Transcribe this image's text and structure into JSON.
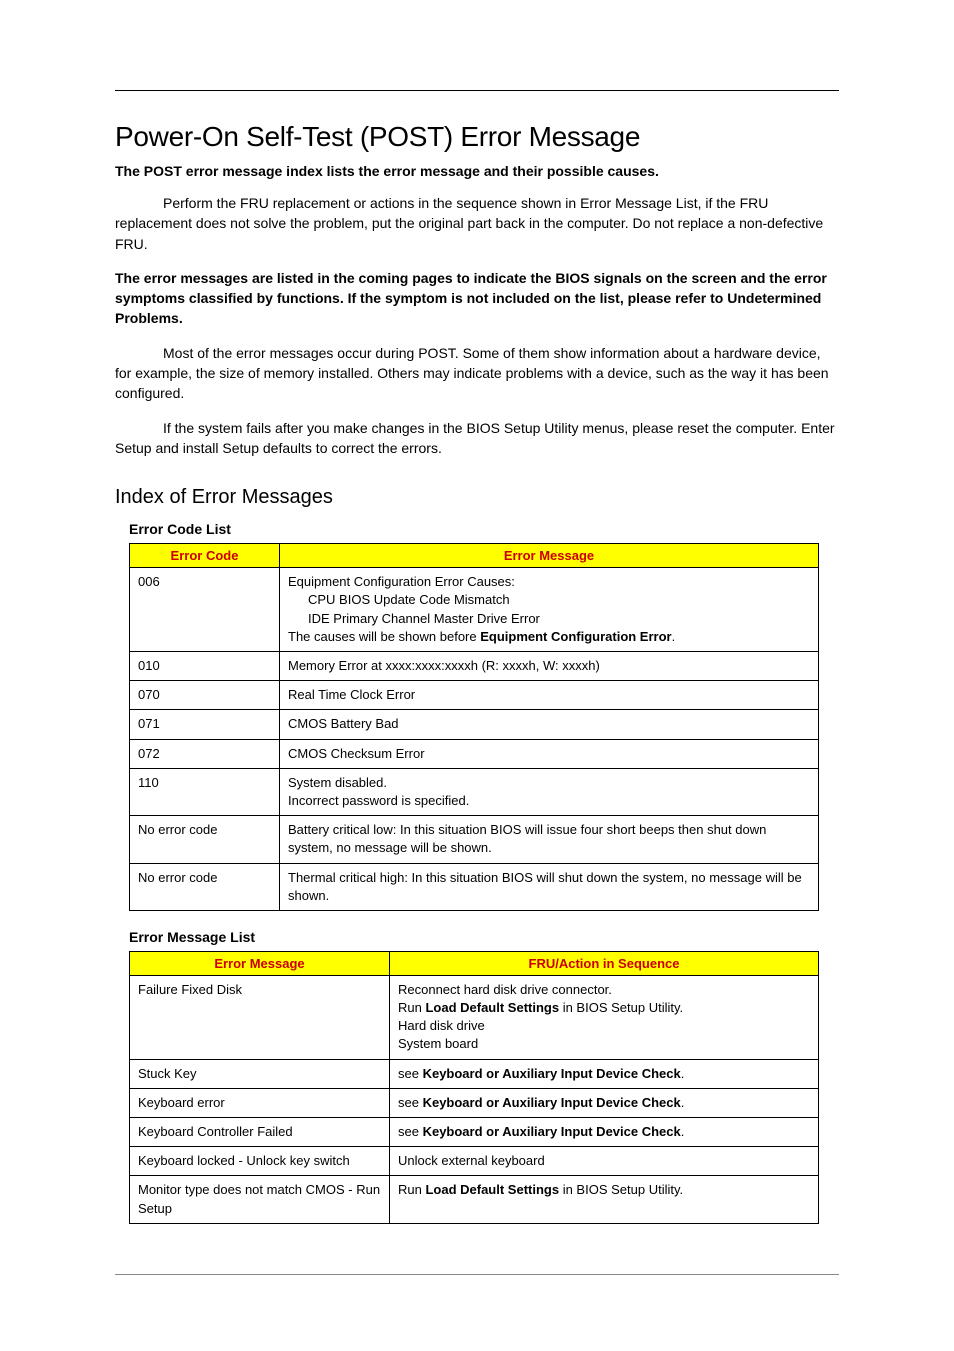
{
  "title": "Power-On Self-Test (POST) Error Message",
  "intro": "The POST error message index lists the error message and their possible causes.",
  "p1": "Perform the FRU replacement or actions in the sequence shown in Error Message List, if the FRU replacement does not solve the problem, put the original part back in the computer. Do not replace a non-defective FRU.",
  "p2_a": "The error messages are listed in the coming pages to indicate the BIOS signals on the screen and the error symptoms classified by functions. If the symptom is not included on the list, please refer to ",
  "p2_b": "Undetermined Problems",
  "p2_c": ".",
  "p3": "Most of the error messages occur during POST. Some of them show information about a hardware device, for example, the size of memory installed. Others may indicate problems with a device, such as the way it has been configured.",
  "p4": "If the system fails after you make changes in the BIOS Setup Utility menus, please reset the computer. Enter Setup and install Setup defaults to correct the errors.",
  "h2": "Index of Error Messages",
  "table1": {
    "label": "Error Code List",
    "headers": [
      "Error Code",
      "Error Message"
    ],
    "rows": [
      {
        "code": "006",
        "msg_lines": [
          {
            "t": "Equipment Configuration Error Causes:",
            "indent": false
          },
          {
            "t": "CPU BIOS Update Code Mismatch",
            "indent": true
          },
          {
            "t": "IDE Primary Channel Master Drive Error",
            "indent": true
          }
        ],
        "msg_tail_a": "The causes will be shown before ",
        "msg_tail_b": "Equipment Configuration Error",
        "msg_tail_c": "."
      },
      {
        "code": "010",
        "msg": "Memory Error at xxxx:xxxx:xxxxh (R: xxxxh, W: xxxxh)"
      },
      {
        "code": "070",
        "msg": "Real Time Clock Error"
      },
      {
        "code": "071",
        "msg": "CMOS Battery Bad"
      },
      {
        "code": "072",
        "msg": "CMOS Checksum Error"
      },
      {
        "code": "110",
        "msg": "System disabled.\nIncorrect password is specified."
      },
      {
        "code": "No error code",
        "msg": "Battery critical low: In this situation BIOS will issue four short beeps then shut down system, no message will be shown."
      },
      {
        "code": "No error code",
        "msg": "Thermal critical high: In this situation BIOS will shut down the system, no message will be shown."
      }
    ]
  },
  "table2": {
    "label": "Error Message List",
    "headers": [
      "Error Message",
      "FRU/Action in Sequence"
    ],
    "rows": [
      {
        "msg": "Failure Fixed Disk",
        "action_lines": [
          {
            "t": "Reconnect hard disk drive connector."
          },
          {
            "t_a": "Run ",
            "t_b": "Load Default Settings",
            "t_c": " in BIOS Setup Utility."
          },
          {
            "t": "Hard disk drive"
          },
          {
            "t": "System board"
          }
        ]
      },
      {
        "msg": "Stuck Key",
        "action_a": "see ",
        "action_b": "Keyboard or Auxiliary Input Device Check",
        "action_c": "."
      },
      {
        "msg": "Keyboard error",
        "action_a": "see ",
        "action_b": "Keyboard or Auxiliary Input Device Check",
        "action_c": "."
      },
      {
        "msg": "Keyboard Controller Failed",
        "action_a": "see ",
        "action_b": "Keyboard or Auxiliary Input Device Check",
        "action_c": "."
      },
      {
        "msg": "Keyboard locked - Unlock key switch",
        "action": "Unlock external keyboard"
      },
      {
        "msg": "Monitor type does not match CMOS - Run Setup",
        "action_a": "Run ",
        "action_b": "Load Default Settings",
        "action_c": " in BIOS Setup Utility."
      }
    ]
  }
}
